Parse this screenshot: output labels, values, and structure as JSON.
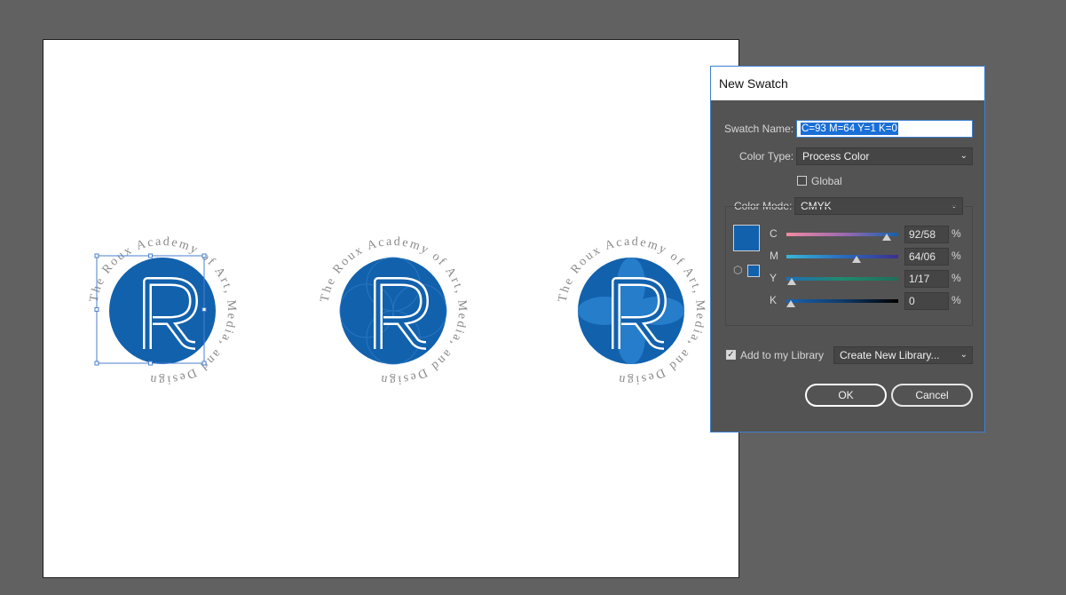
{
  "artwork": {
    "circle_text": "The Roux Academy of Art, Media, and Design",
    "letter": "R",
    "brand_color": "#1261ad",
    "text_color": "#8a8a8a"
  },
  "dialog": {
    "title": "New Swatch",
    "swatch_name_label": "Swatch Name:",
    "swatch_name_value": "C=93 M=64 Y=1 K=0",
    "color_type_label": "Color Type:",
    "color_type_value": "Process Color",
    "global_label": "Global",
    "global_checked": false,
    "color_mode_label": "Color Mode:",
    "color_mode_value": "CMYK",
    "swatch_color": "#1261ad",
    "channels": [
      {
        "label": "C",
        "value": "92/58",
        "level": 0.93
      },
      {
        "label": "M",
        "value": "64/06",
        "level": 0.64
      },
      {
        "label": "Y",
        "value": "1/17",
        "level": 0.01
      },
      {
        "label": "K",
        "value": "0",
        "level": 0.0
      }
    ],
    "percent_sign": "%",
    "add_library_label": "Add to my Library",
    "add_library_checked": true,
    "library_value": "Create New Library...",
    "ok_label": "OK",
    "cancel_label": "Cancel"
  }
}
